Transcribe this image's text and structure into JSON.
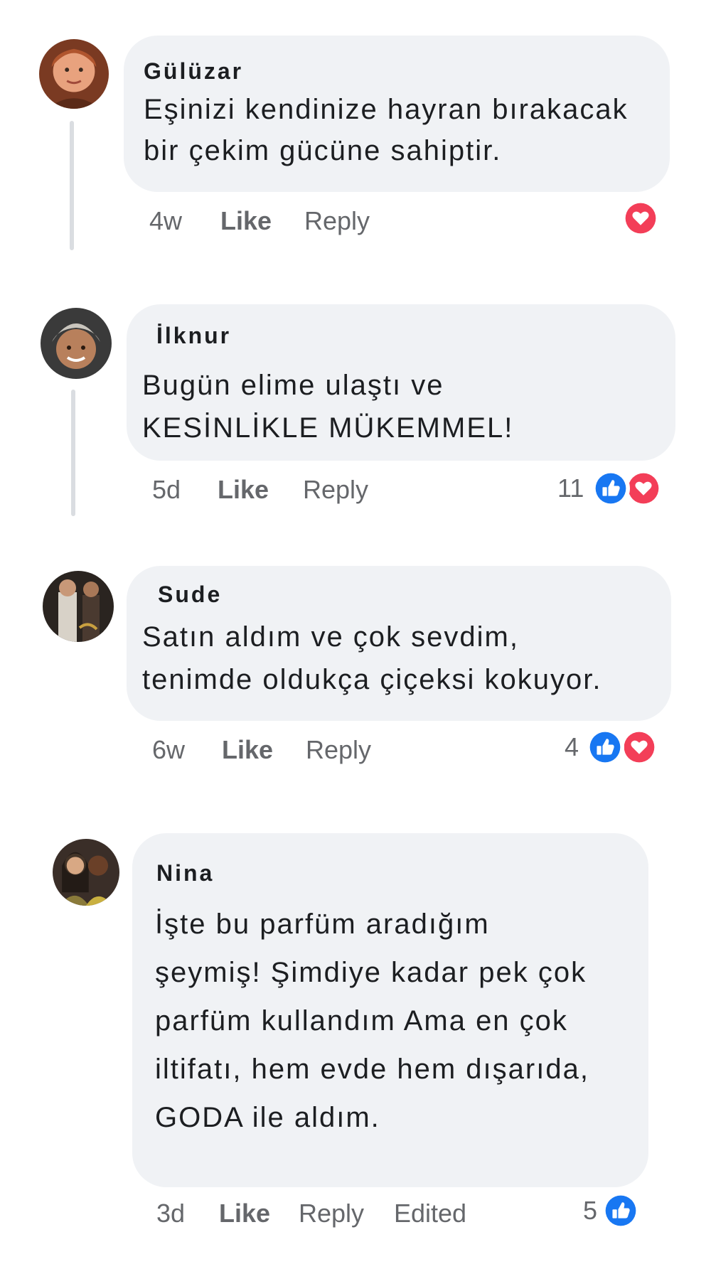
{
  "colors": {
    "bubble": "#f0f2f5",
    "like_blue": "#1877f2",
    "love_red": "#f33e58",
    "meta_gray": "#65676b"
  },
  "comments": [
    {
      "author": "Gülüzar",
      "lines": [
        "Eşinizi kendinize hayran bırakacak",
        "bir çekim gücüne sahiptir."
      ],
      "time": "4w",
      "like": "Like",
      "reply": "Reply",
      "reactions": [
        "love-icon"
      ]
    },
    {
      "author": "İlknur",
      "lines": [
        "Bugün elime ulaştı ve",
        "KESİNLİKLE MÜKEMMEL!"
      ],
      "time": "5d",
      "like": "Like",
      "reply": "Reply",
      "reaction_count": "11",
      "reactions": [
        "thumbs-up-icon",
        "love-icon"
      ]
    },
    {
      "author": "Sude",
      "lines": [
        "Satın aldım ve çok sevdim,",
        "tenimde oldukça çiçeksi kokuyor."
      ],
      "time": "6w",
      "like": "Like",
      "reply": "Reply",
      "reaction_count": "4",
      "reactions": [
        "thumbs-up-icon",
        "love-icon"
      ]
    },
    {
      "author": "Nina",
      "lines": [
        "İşte bu parfüm aradığım",
        "şeymiş! Şimdiye kadar pek çok",
        "parfüm kullandım Ama en çok",
        "iltifatı, hem evde hem dışarıda,",
        "GODA ile aldım."
      ],
      "time": "3d",
      "like": "Like",
      "reply": "Reply",
      "edited": "Edited",
      "reaction_count": "5",
      "reactions": [
        "thumbs-up-icon"
      ]
    }
  ]
}
